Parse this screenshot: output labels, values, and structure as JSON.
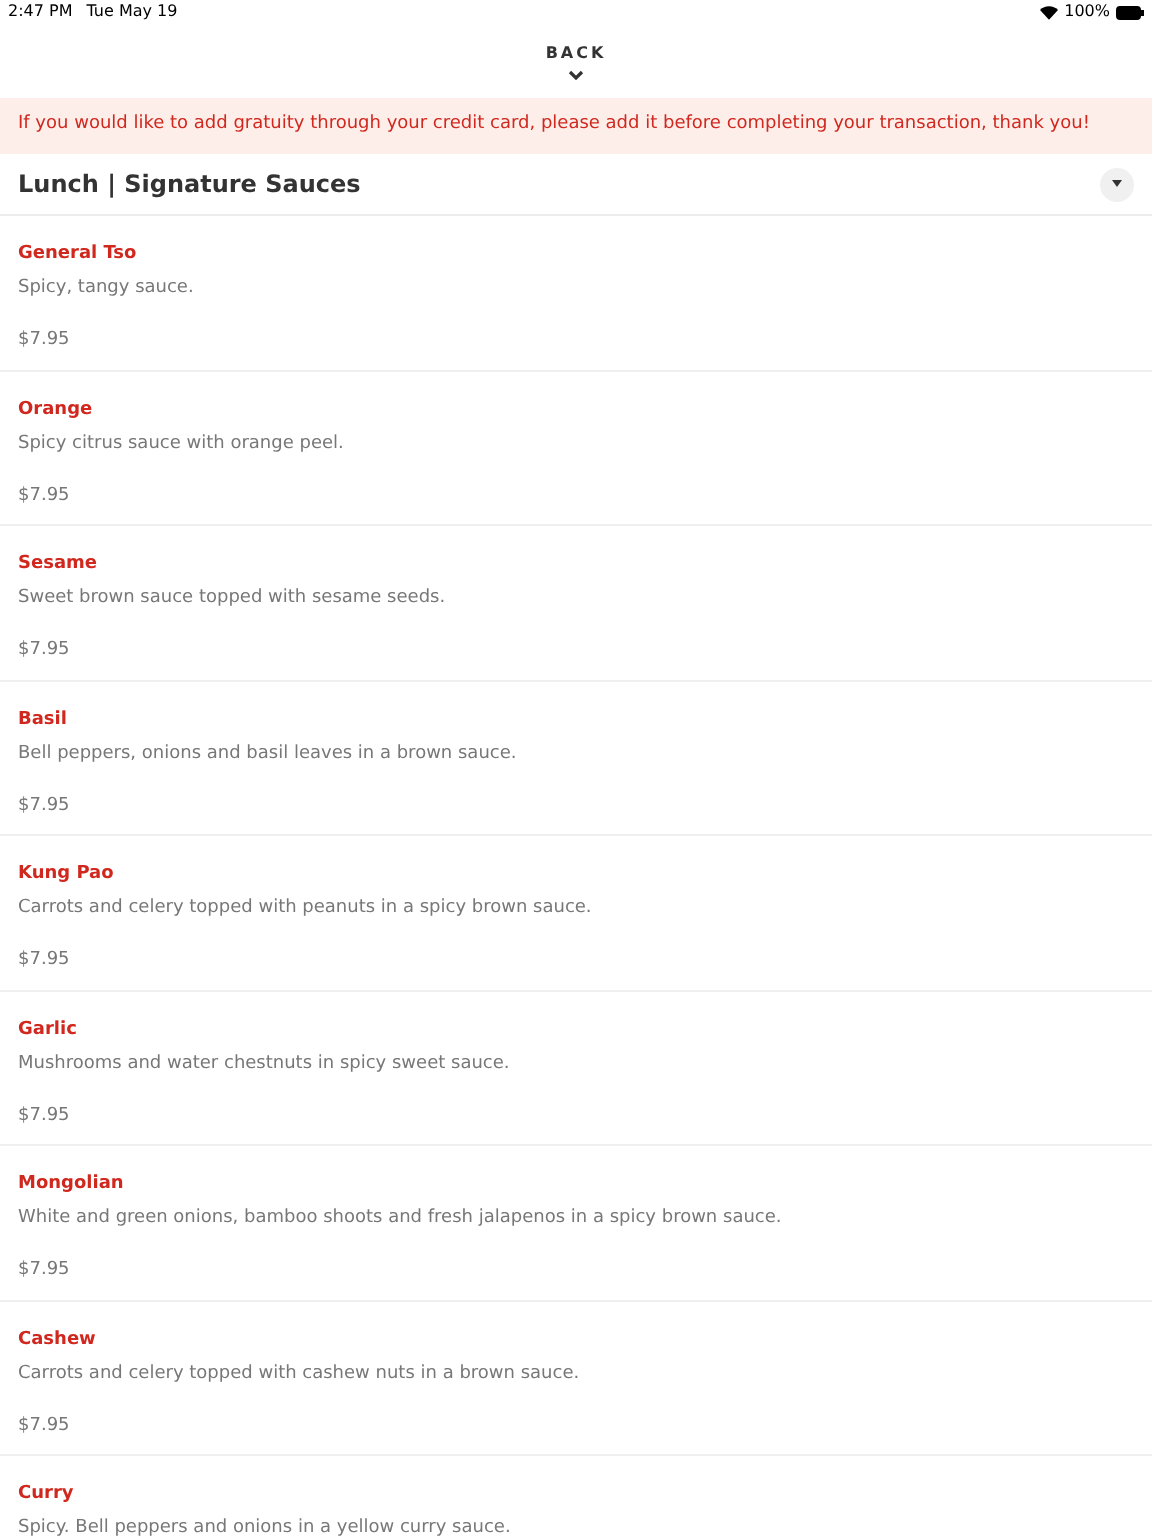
{
  "status_bar": {
    "time": "2:47 PM",
    "date": "Tue May 19",
    "battery": "100%"
  },
  "back": {
    "label": "BACK"
  },
  "notice": "If you would like to add gratuity through your credit card, please add it before completing your transaction, thank you!",
  "section": {
    "title": "Lunch | Signature Sauces",
    "expanded": true
  },
  "items": [
    {
      "name": "General Tso",
      "description": "Spicy, tangy sauce.",
      "price": "$7.95"
    },
    {
      "name": "Orange",
      "description": "Spicy citrus sauce with orange peel.",
      "price": "$7.95"
    },
    {
      "name": "Sesame",
      "description": "Sweet brown sauce topped with sesame seeds.",
      "price": "$7.95"
    },
    {
      "name": "Basil",
      "description": "Bell peppers, onions and basil leaves in a brown sauce.",
      "price": "$7.95"
    },
    {
      "name": "Kung Pao",
      "description": "Carrots and celery topped with peanuts in a spicy brown sauce.",
      "price": "$7.95"
    },
    {
      "name": "Garlic",
      "description": "Mushrooms and water chestnuts in spicy sweet sauce.",
      "price": "$7.95"
    },
    {
      "name": "Mongolian",
      "description": "White and green onions, bamboo shoots and fresh jalapenos in a spicy brown sauce.",
      "price": "$7.95"
    },
    {
      "name": "Cashew",
      "description": "Carrots and celery topped with cashew nuts in a brown sauce.",
      "price": "$7.95"
    },
    {
      "name": "Curry",
      "description": "Spicy. Bell peppers and onions in a yellow curry sauce."
    }
  ]
}
